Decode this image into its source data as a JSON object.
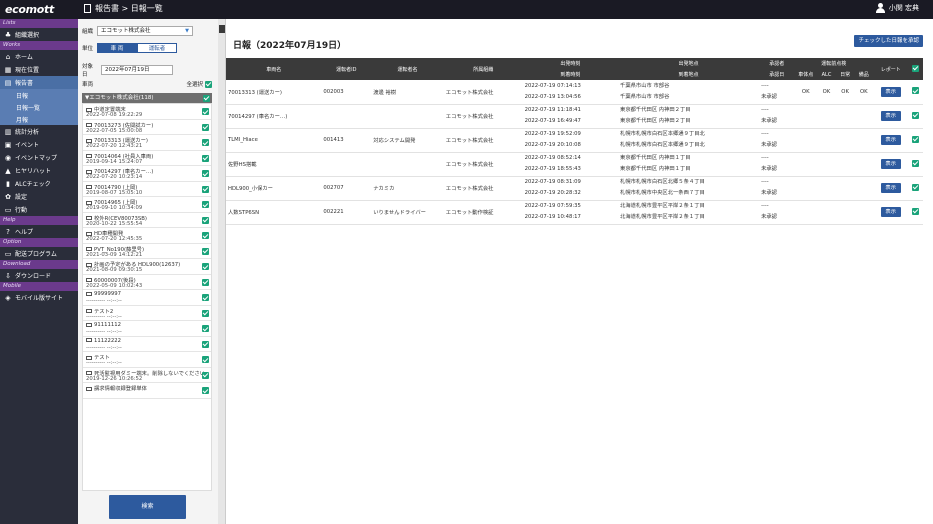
{
  "app": {
    "logo": "ecomott",
    "breadcrumb": "報告書 > 日報一覧",
    "user": "小関 宏典"
  },
  "sidebar": {
    "sections": [
      {
        "label": "Lists",
        "items": [
          {
            "label": "組織選択",
            "icon": "org-icon"
          }
        ]
      },
      {
        "label": "Works",
        "items": [
          {
            "label": "ホーム",
            "icon": "home-icon"
          },
          {
            "label": "現在位置",
            "icon": "map-icon"
          },
          {
            "label": "報告書",
            "icon": "report-icon",
            "active": true
          },
          {
            "label": "日報",
            "sub": true
          },
          {
            "label": "日報一覧",
            "sub": true
          },
          {
            "label": "月報",
            "sub": true
          },
          {
            "label": "統計分析",
            "icon": "chart-icon"
          },
          {
            "label": "イベント",
            "icon": "event-icon"
          },
          {
            "label": "イベントマップ",
            "icon": "pin-icon"
          },
          {
            "label": "ヒヤリハット",
            "icon": "warning-icon"
          },
          {
            "label": "ALCチェック",
            "icon": "alc-icon"
          },
          {
            "label": "設定",
            "icon": "gear-icon"
          },
          {
            "label": "行動",
            "icon": "action-icon"
          }
        ]
      },
      {
        "label": "Help",
        "items": [
          {
            "label": "ヘルプ",
            "icon": "help-icon"
          }
        ]
      },
      {
        "label": "Option",
        "items": [
          {
            "label": "配送プログラム",
            "icon": "monitor-icon"
          }
        ]
      },
      {
        "label": "Download",
        "items": [
          {
            "label": "ダウンロード",
            "icon": "download-icon"
          }
        ]
      },
      {
        "label": "Mobile",
        "items": [
          {
            "label": "モバイル版サイト",
            "icon": "mobile-icon"
          }
        ]
      }
    ]
  },
  "filter": {
    "org_label": "組織",
    "org_value": "エコモット株式会社",
    "unit_label": "単位",
    "unit_options": [
      "車 両",
      "運転者"
    ],
    "date_label": "対象日",
    "date_value": "2022年07月19日",
    "vehicle_label": "車両",
    "select_all_label": "全選択",
    "group_label": "▼エコモット株式会社(118)",
    "vehicles": [
      {
        "name": "中道定置端末",
        "date": "2022-07-08 19:22:29"
      },
      {
        "name": "70013273 (佐間試カー)",
        "date": "2022-07-05 15:00:08"
      },
      {
        "name": "70013313 (運送カー)",
        "date": "2022-07-20 12:43:21"
      },
      {
        "name": "70014064 (社員入車両)",
        "date": "2019-09-14 15:24:07"
      },
      {
        "name": "70014297 (車名カー…)",
        "date": "2022-07-20 10:23:14"
      },
      {
        "name": "70014790 (上岡)",
        "date": "2019-08-07 15:05:10"
      },
      {
        "name": "70014965 (上岡)",
        "date": "2019-09-10 10:34:09"
      },
      {
        "name": "校外R(CEV80073SB)",
        "date": "2020-10-22 15:55:54"
      },
      {
        "name": "HD車種開発",
        "date": "2022-07-20 12:45:35"
      },
      {
        "name": "PVT_No190(藤里号)",
        "date": "2021-03-09 14:12:21"
      },
      {
        "name": "計画の予定がある HDL900(12637)",
        "date": "2021-08-09 09:30:15"
      },
      {
        "name": "60000007(後段)",
        "date": "2022-05-09 10:02:43"
      },
      {
        "name": "99999997",
        "date": "---------- --:--:--"
      },
      {
        "name": "テスト2",
        "date": "---------- --:--:--"
      },
      {
        "name": "91111112",
        "date": "---------- --:--:--"
      },
      {
        "name": "11122222",
        "date": "---------- --:--:--"
      },
      {
        "name": "テスト",
        "date": "---------- --:--:--"
      },
      {
        "name": "死活監視用ダミー端末。削除しないでください。",
        "date": "2019-12-26 10:26:52"
      },
      {
        "name": "講求情報収録登録単体",
        "date": ""
      }
    ],
    "search_button": "検索"
  },
  "main": {
    "title": "日報（2022年07月19日）",
    "approve_button": "チェックした日報を承認",
    "headers": [
      "車両名",
      "運転者ID",
      "運転者名",
      "所属組織",
      "出発時刻",
      "到着時刻",
      "出発地点",
      "到着地点",
      "承認者",
      "承認日",
      "車体点",
      "ALC",
      "日常",
      "備品",
      "レポート"
    ],
    "header_groups": {
      "time": "出発時刻",
      "place": "出発地点",
      "approver": "承認者",
      "check": "運転前点検"
    },
    "show_label": "表示",
    "rows": [
      {
        "vehicle": "70013313 (運送カー)",
        "driver_id": "002003",
        "driver": "渡邊 裕樹",
        "org": "エコモット株式会社",
        "dep": "2022-07-19 07:14:13",
        "arr": "2022-07-19 13:04:56",
        "dep_place": "千葉県市山市 市部谷",
        "arr_place": "千葉県市山市 市部谷",
        "approver": "----",
        "approve_date": "未承認",
        "c1": "OK",
        "c2": "OK",
        "c3": "OK",
        "c4": "OK"
      },
      {
        "vehicle": "70014297 (車名カー…)",
        "driver_id": "",
        "driver": "",
        "org": "エコモット株式会社",
        "dep": "2022-07-19 11:18:41",
        "arr": "2022-07-19 16:49:47",
        "dep_place": "東京都千代田区 内神田２丁目",
        "arr_place": "東京都千代田区 内神田２丁目",
        "approver": "----",
        "approve_date": "未承認",
        "c1": "",
        "c2": "",
        "c3": "",
        "c4": ""
      },
      {
        "vehicle": "TLMI_Hiace",
        "driver_id": "001413",
        "driver": "対応システム開発",
        "org": "エコモット株式会社",
        "dep": "2022-07-19 19:52:09",
        "arr": "2022-07-19 20:10:08",
        "dep_place": "札幌市札幌市白石区本郷通９丁目北",
        "arr_place": "札幌市札幌市白石区本郷通９丁目北",
        "approver": "----",
        "approve_date": "未承認",
        "c1": "",
        "c2": "",
        "c3": "",
        "c4": ""
      },
      {
        "vehicle": "佐野HS搭載",
        "driver_id": "",
        "driver": "",
        "org": "エコモット株式会社",
        "dep": "2022-07-19 08:52:14",
        "arr": "2022-07-19 18:55:43",
        "dep_place": "東京都千代田区 内神田１丁目",
        "arr_place": "東京都千代田区 内神田１丁目",
        "approver": "----",
        "approve_date": "未承認",
        "c1": "",
        "c2": "",
        "c3": "",
        "c4": ""
      },
      {
        "vehicle": "HDL900_小保カー",
        "driver_id": "002707",
        "driver": "ナカミカ",
        "org": "エコモット株式会社",
        "dep": "2022-07-19 08:31:09",
        "arr": "2022-07-19 20:28:32",
        "dep_place": "札幌市札幌市白石区北郷５条４丁目",
        "arr_place": "札幌市札幌市中央区北一条西７丁目",
        "approver": "----",
        "approve_date": "未承認",
        "c1": "",
        "c2": "",
        "c3": "",
        "c4": ""
      },
      {
        "vehicle": "人数STP6SN",
        "driver_id": "002221",
        "driver": "いりませんドライバー",
        "org": "エコモット動作検証",
        "dep": "2022-07-19 07:59:35",
        "arr": "2022-07-19 10:48:17",
        "dep_place": "北海道札幌市豊平区平岸２条１丁目",
        "arr_place": "北海道札幌市豊平区平岸２条１丁目",
        "approver": "----",
        "approve_date": "未承認",
        "c1": "",
        "c2": "",
        "c3": "",
        "c4": ""
      }
    ]
  }
}
